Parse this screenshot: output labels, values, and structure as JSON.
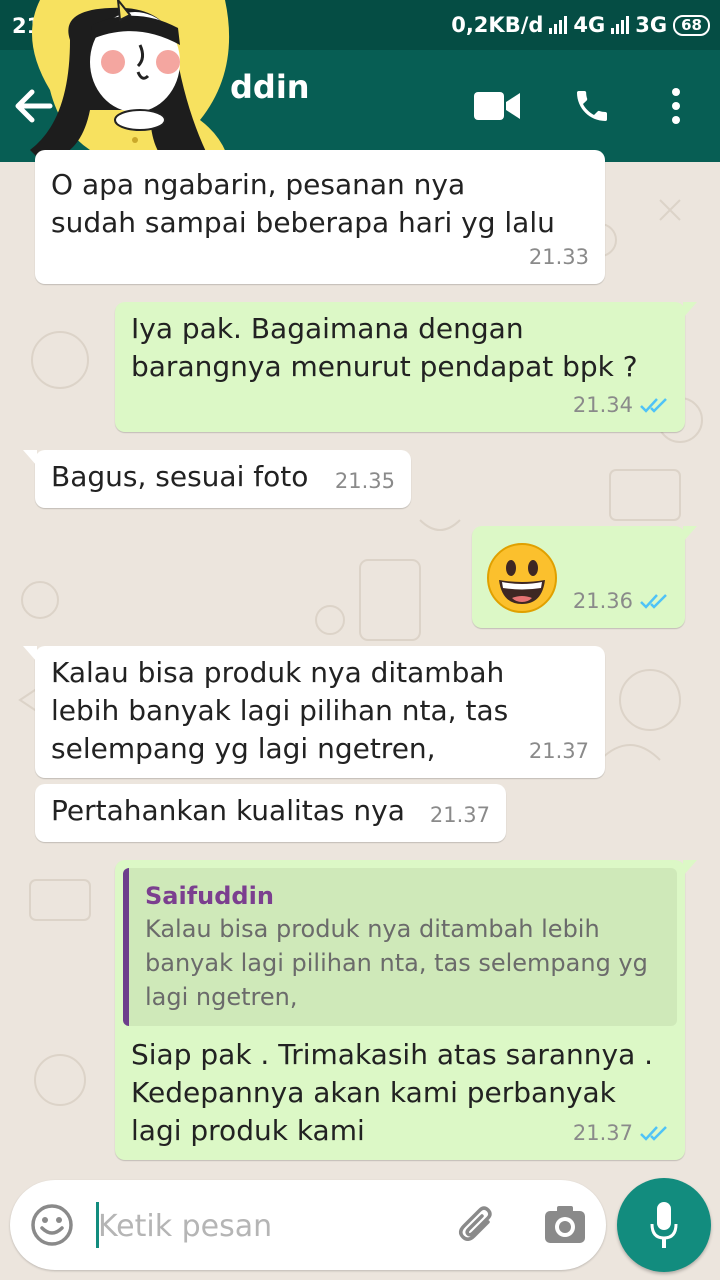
{
  "status_bar": {
    "time": "21.3",
    "network_speed": "0,2KB/d",
    "network_1": "4G",
    "network_2": "3G",
    "battery": "68"
  },
  "header": {
    "contact_name": "ddin",
    "icons": [
      "back-arrow-icon",
      "video-call-icon",
      "phone-icon",
      "more-vert-icon"
    ]
  },
  "messages": [
    {
      "dir": "in",
      "text": "O   apa ngabarin, pesanan nya\nsudah sampai beberapa hari yg lalu",
      "time": "21.33"
    },
    {
      "dir": "out",
      "text": "Iya pak. Bagaimana dengan\nbarangnya menurut pendapat bpk ?",
      "time": "21.34",
      "ticks": "read"
    },
    {
      "dir": "in",
      "text": "Bagus, sesuai foto",
      "time": "21.35"
    },
    {
      "dir": "out",
      "emoji": "grinning-face",
      "time": "21.36",
      "ticks": "read"
    },
    {
      "dir": "in",
      "text": "Kalau bisa produk nya ditambah\nlebih  banyak lagi pilihan nta, tas\nselempang yg lagi ngetren,",
      "time": "21.37"
    },
    {
      "dir": "in",
      "text": "Pertahankan kualitas nya",
      "time": "21.37"
    },
    {
      "dir": "out",
      "quote_name": "Saifuddin",
      "quote_text": "Kalau bisa produk nya ditambah lebih\nbanyak lagi pilihan nta, tas selempang yg\nlagi ngetren,",
      "text": "Siap pak . Trimakasih atas sarannya .\nKedepannya akan kami perbanyak\nlagi produk kami",
      "time": "21.37",
      "ticks": "read"
    }
  ],
  "composer": {
    "placeholder": "Ketik pesan",
    "icons": [
      "emoji-icon",
      "attach-icon",
      "camera-icon",
      "mic-icon"
    ]
  },
  "colors": {
    "status_bar": "#054d44",
    "app_bar": "#075e54",
    "outgoing_bubble": "#dcf8c6",
    "incoming_bubble": "#ffffff",
    "read_ticks": "#4fc3f7",
    "accent": "#128c7e",
    "quote_author": "#7b3f8f"
  }
}
